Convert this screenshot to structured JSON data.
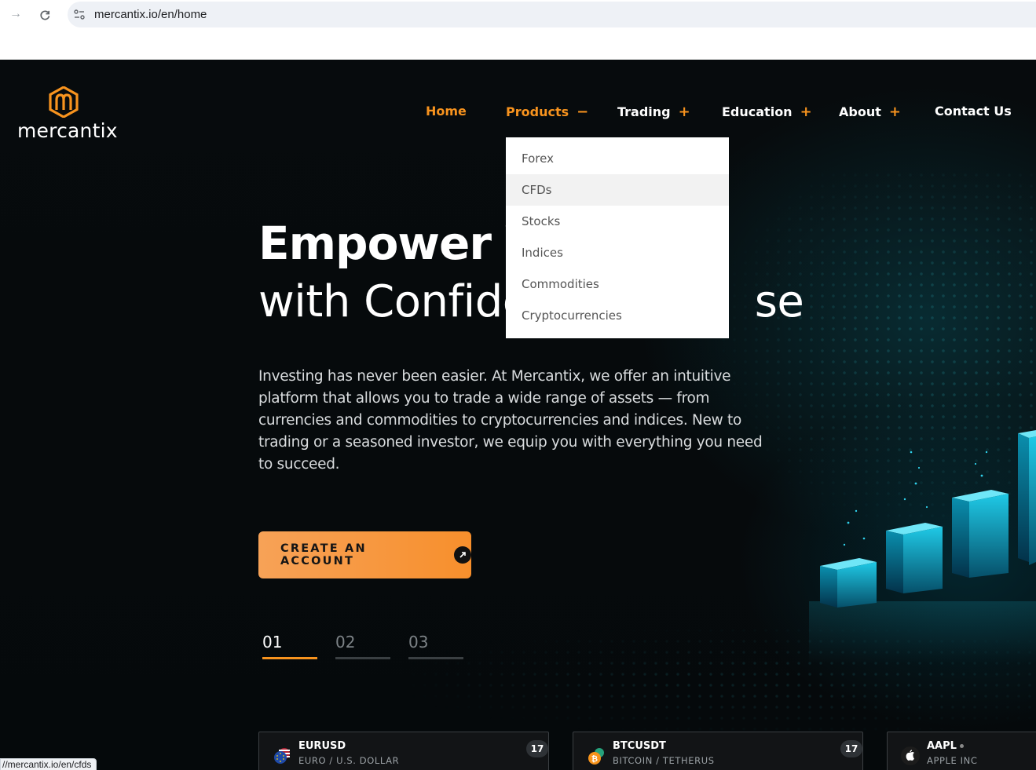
{
  "browser": {
    "url": "mercantix.io/en/home",
    "status_url": "//mercantix.io/en/cfds"
  },
  "logo": {
    "text": "mercantix"
  },
  "nav": {
    "home": "Home",
    "products": "Products",
    "products_sign": "−",
    "trading": "Trading",
    "education": "Education",
    "about": "About",
    "contact": "Contact Us",
    "plus": "+"
  },
  "dropdown": {
    "items": [
      "Forex",
      "CFDs",
      "Stocks",
      "Indices",
      "Commodities",
      "Cryptocurrencies"
    ]
  },
  "hero": {
    "title_line1": "Empower Yo",
    "title_line2_a": "with Confide",
    "title_line2_b": "se",
    "description": "Investing has never been easier. At Mercantix, we offer an intuitive platform that allows you to trade a wide range of assets — from currencies and commodities to cryptocurrencies and indices. New to trading or a seasoned investor, we equip you with everything you need to succeed.",
    "cta_label": "CREATE AN ACCOUNT"
  },
  "slides": [
    "01",
    "02",
    "03"
  ],
  "tickers": [
    {
      "symbol": "EURUSD",
      "name": "EURO / U.S. DOLLAR",
      "badge": "17"
    },
    {
      "symbol": "BTCUSDT",
      "name": "BITCOIN / TETHERUS",
      "badge": "17"
    },
    {
      "symbol": "AAPL",
      "name": "APPLE INC"
    }
  ],
  "colors": {
    "accent": "#f7931e",
    "background": "#05090b",
    "teal": "#19b6d1"
  }
}
